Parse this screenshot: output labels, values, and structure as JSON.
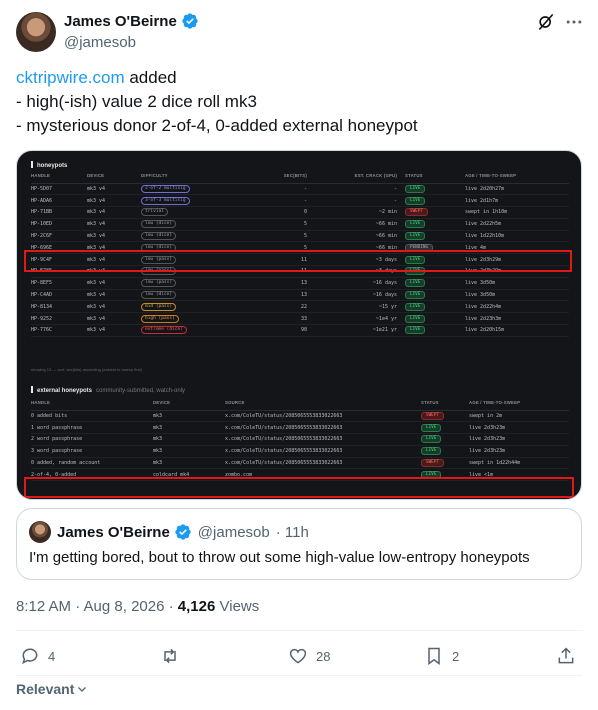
{
  "author": {
    "name": "James O'Beirne",
    "handle": "@jamesob"
  },
  "tweet": {
    "link_text": "cktripwire.com",
    "line1_rest": " added",
    "line2": "- high(-ish) value 2 dice roll mk3",
    "line3": "- mysterious donor 2-of-4, 0-added external honeypot"
  },
  "media": {
    "honeypots": {
      "title": "honeypots",
      "headers": [
        "HANDLE",
        "DEVICE",
        "DIFFICULTY",
        "SEC(BITS)",
        "EST. CRACK (GPU)",
        "STATUS",
        "AGE / TIME-TO-SWEEP"
      ],
      "rows": [
        {
          "handle": "HP-5D07",
          "device": "mk3 v4",
          "difficulty": "2-of-2 multisig",
          "tag": "ms",
          "bits": "-",
          "crack": "-",
          "status": "LIVE",
          "st": "live",
          "age": "live 2d20h27m"
        },
        {
          "handle": "HP-ADA6",
          "device": "mk3 v4",
          "difficulty": "3-of-3 multisig",
          "tag": "ms",
          "bits": "-",
          "crack": "-",
          "status": "LIVE",
          "st": "live",
          "age": "live 2d1h7m"
        },
        {
          "handle": "HP-71BB",
          "device": "mk3 v4",
          "difficulty": "trivial",
          "tag": "",
          "bits": "0",
          "crack": "~2 min",
          "status": "SWEPT",
          "st": "swept",
          "age": "swept in 1h10m"
        },
        {
          "handle": "HP-10ED",
          "device": "mk3 v4",
          "difficulty": "low (dice)",
          "tag": "",
          "bits": "5",
          "crack": "~66 min",
          "status": "LIVE",
          "st": "live",
          "age": "live 2d22h5m"
        },
        {
          "handle": "HP-2C6F",
          "device": "mk3 v4",
          "difficulty": "low (dice)",
          "tag": "",
          "bits": "5",
          "crack": "~66 min",
          "status": "LIVE",
          "st": "live",
          "age": "live 1d22h10m"
        },
        {
          "handle": "HP-696E",
          "device": "mk3 v4",
          "difficulty": "low (dice)",
          "tag": "",
          "bits": "5",
          "crack": "~66 min",
          "status": "PENDING",
          "st": "pending",
          "age": "live 4m"
        },
        {
          "handle": "HP-9C4F",
          "device": "mk3 v4",
          "difficulty": "low (pass)",
          "tag": "",
          "bits": "11",
          "crack": "~3 days",
          "status": "LIVE",
          "st": "live",
          "age": "live 2d3h29m"
        },
        {
          "handle": "HP-E786",
          "device": "mk3 v4",
          "difficulty": "low (pass)",
          "tag": "",
          "bits": "11",
          "crack": "~3 days",
          "status": "LIVE",
          "st": "live",
          "age": "live 2d3h29m"
        },
        {
          "handle": "HP-8EF5",
          "device": "mk3 v4",
          "difficulty": "low (pass)",
          "tag": "",
          "bits": "13",
          "crack": "~16 days",
          "status": "LIVE",
          "st": "live",
          "age": "live 3d50m"
        },
        {
          "handle": "HP-C4AD",
          "device": "mk3 v4",
          "difficulty": "low (dice)",
          "tag": "",
          "bits": "13",
          "crack": "~16 days",
          "status": "LIVE",
          "st": "live",
          "age": "live 3d50m"
        },
        {
          "handle": "HP-8134",
          "device": "mk3 v4",
          "difficulty": "mid (pass)",
          "tag": "mid",
          "bits": "22",
          "crack": "~15 yr",
          "status": "LIVE",
          "st": "live",
          "age": "live 2d22h4m"
        },
        {
          "handle": "HP-9252",
          "device": "mk3 v4",
          "difficulty": "high (pass)",
          "tag": "high",
          "bits": "33",
          "crack": "~1e4 yr",
          "status": "LIVE",
          "st": "live",
          "age": "live 2d23h3m"
        },
        {
          "handle": "HP-776C",
          "device": "mk3 v4",
          "difficulty": "extreme (dice)",
          "tag": "ext",
          "bits": "90",
          "crack": "~1e21 yr",
          "status": "LIVE",
          "st": "live",
          "age": "live 2d20h15m"
        }
      ],
      "note": "showing 13 — sort: sec(bits) ascending (easiest to sweep first)"
    },
    "external": {
      "title": "external honeypots",
      "subtitle": "community-submitted, watch-only",
      "headers": [
        "HANDLE",
        "DEVICE",
        "SOURCE",
        "STATUS",
        "AGE / TIME-TO-SWEEP"
      ],
      "rows": [
        {
          "handle": "0 added bits",
          "device": "mk3",
          "source": "x.com/ColeTU/status/2085065553833022663",
          "status": "SWEPT",
          "st": "swept",
          "age": "swept in 2m"
        },
        {
          "handle": "1 word passphrase",
          "device": "mk3",
          "source": "x.com/ColeTU/status/2085065553833022663",
          "status": "LIVE",
          "st": "live",
          "age": "live 2d3h23m"
        },
        {
          "handle": "2 word passphrase",
          "device": "mk3",
          "source": "x.com/ColeTU/status/2085065553833022663",
          "status": "LIVE",
          "st": "live",
          "age": "live 2d3h23m"
        },
        {
          "handle": "3 word passphrase",
          "device": "mk3",
          "source": "x.com/ColeTU/status/2085065553833022663",
          "status": "LIVE",
          "st": "live",
          "age": "live 2d3h23m"
        },
        {
          "handle": "0 added, random account",
          "device": "mk3",
          "source": "x.com/ColeTU/status/2085065553833022663",
          "status": "SWEPT",
          "st": "swept",
          "age": "swept in 1d22h44m"
        },
        {
          "handle": "2-of-4, 0-added",
          "device": "coldcard mk4",
          "source": "zombo.com",
          "status": "LIVE",
          "st": "live",
          "age": "live <1m"
        }
      ]
    }
  },
  "quote": {
    "name": "James O'Beirne",
    "handle": "@jamesob",
    "time": "· 11h",
    "text": "I'm getting bored, bout to throw out some high-value low-entropy honeypots"
  },
  "meta": {
    "timestamp": "8:12 AM · Aug 8, 2026",
    "dot": " · ",
    "views_count": "4,126",
    "views_label": " Views"
  },
  "actions": {
    "replies": "4",
    "reposts": "",
    "likes": "28",
    "bookmarks": "2"
  },
  "sort": {
    "label": "Relevant"
  },
  "colors": {
    "accent": "#1d9bf0",
    "highlight": "#e01818"
  }
}
